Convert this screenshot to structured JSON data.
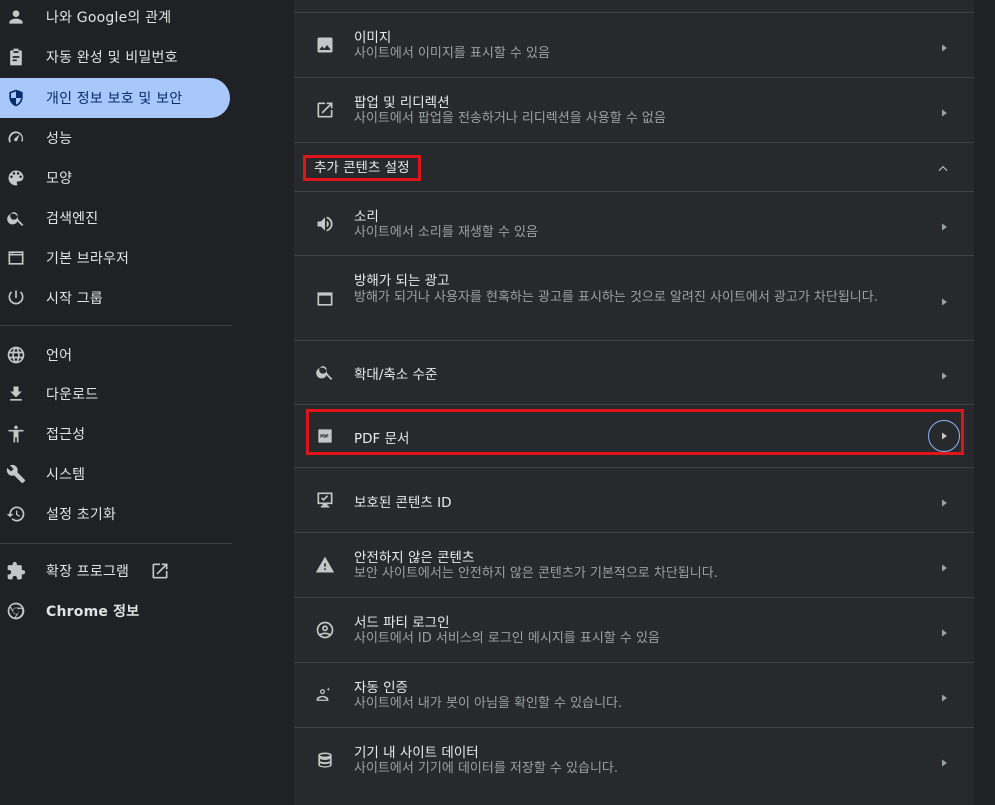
{
  "sidebar": {
    "items": [
      {
        "label": "나와 Google의 관계",
        "icon": "person-icon"
      },
      {
        "label": "자동 완성 및 비밀번호",
        "icon": "clipboard-icon"
      },
      {
        "label": "개인 정보 보호 및 보안",
        "icon": "shield-icon",
        "active": true
      },
      {
        "label": "성능",
        "icon": "speedometer-icon"
      },
      {
        "label": "모양",
        "icon": "palette-icon"
      },
      {
        "label": "검색엔진",
        "icon": "search-icon"
      },
      {
        "label": "기본 브라우저",
        "icon": "browser-window-icon"
      },
      {
        "label": "시작 그룹",
        "icon": "power-icon"
      },
      {
        "label": "언어",
        "icon": "globe-icon"
      },
      {
        "label": "다운로드",
        "icon": "download-icon"
      },
      {
        "label": "접근성",
        "icon": "accessibility-icon"
      },
      {
        "label": "시스템",
        "icon": "wrench-icon"
      },
      {
        "label": "설정 초기화",
        "icon": "history-icon"
      },
      {
        "label": "확장 프로그램",
        "icon": "puzzle-icon",
        "external": true
      },
      {
        "label": "Chrome 정보",
        "icon": "chrome-logo-icon"
      }
    ]
  },
  "content": {
    "rows_top": [
      {
        "title": "이미지",
        "sub": "사이트에서 이미지를 표시할 수 있음",
        "icon": "image-icon"
      },
      {
        "title": "팝업 및 리디렉션",
        "sub": "사이트에서 팝업을 전송하거나 리디렉션을 사용할 수 없음",
        "icon": "open-in-new-icon"
      }
    ],
    "section_title": "추가 콘텐츠 설정",
    "rows_extra": [
      {
        "title": "소리",
        "sub": "사이트에서 소리를 재생할 수 있음",
        "icon": "volume-icon"
      },
      {
        "title": "방해가 되는 광고",
        "sub": "방해가 되거나 사용자를 현혹하는 광고를 표시하는 것으로 알려진 사이트에서 광고가 차단됩니다.",
        "icon": "ad-window-icon"
      },
      {
        "title": "확대/축소 수준",
        "sub": "",
        "icon": "zoom-icon"
      },
      {
        "title": "PDF 문서",
        "sub": "",
        "icon": "pdf-icon"
      },
      {
        "title": "보호된 콘텐츠 ID",
        "sub": "",
        "icon": "protected-content-icon"
      },
      {
        "title": "안전하지 않은 콘텐츠",
        "sub": "보안 사이트에서는 안전하지 않은 콘텐츠가 기본적으로 차단됩니다.",
        "icon": "warning-icon"
      },
      {
        "title": "서드 파티 로그인",
        "sub": "사이트에서 ID 서비스의 로그인 메시지를 표시할 수 있음",
        "icon": "account-circle-icon"
      },
      {
        "title": "자동 인증",
        "sub": "사이트에서 내가 봇이 아님을 확인할 수 있습니다.",
        "icon": "auto-verify-icon"
      },
      {
        "title": "기기 내 사이트 데이터",
        "sub": "사이트에서 기기에 데이터를 저장할 수 있습니다.",
        "icon": "database-icon"
      }
    ]
  },
  "colors": {
    "background": "#202124",
    "card": "#28292c",
    "active_nav": "#a8c7fa",
    "highlight": "#e0141b",
    "focus_ring": "#8ab4f8"
  }
}
